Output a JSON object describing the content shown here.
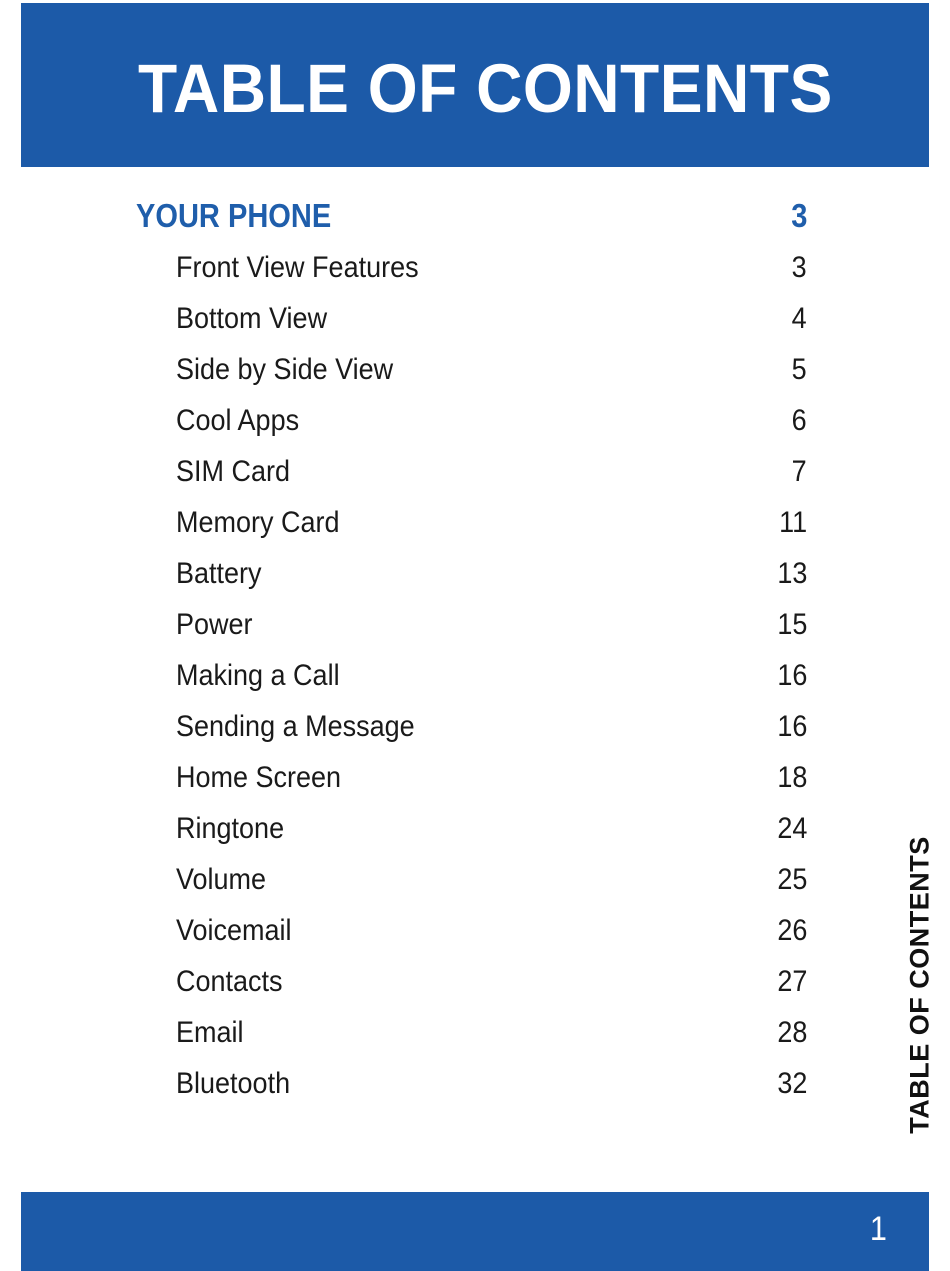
{
  "document": {
    "page_title": "TABLE OF CONTENTS",
    "page_number": "1",
    "side_tab_label": "TABLE OF CONTENTS"
  },
  "colors": {
    "brand_blue": "#1c5aa8",
    "heading_blue": "#1f5eab",
    "body_text": "#1a1a1a",
    "banner_text": "#ffffff"
  },
  "toc": {
    "section": {
      "label": "YOUR PHONE",
      "page": "3"
    },
    "entries": [
      {
        "label": "Front View Features",
        "page": "3"
      },
      {
        "label": "Bottom View",
        "page": "4"
      },
      {
        "label": "Side by Side View",
        "page": "5"
      },
      {
        "label": "Cool Apps",
        "page": "6"
      },
      {
        "label": "SIM Card",
        "page": "7"
      },
      {
        "label": "Memory Card",
        "page": "11"
      },
      {
        "label": "Battery",
        "page": "13"
      },
      {
        "label": "Power",
        "page": "15"
      },
      {
        "label": "Making a Call",
        "page": "16"
      },
      {
        "label": "Sending a Message",
        "page": "16"
      },
      {
        "label": "Home Screen",
        "page": "18"
      },
      {
        "label": "Ringtone",
        "page": "24"
      },
      {
        "label": "Volume",
        "page": "25"
      },
      {
        "label": "Voicemail",
        "page": "26"
      },
      {
        "label": "Contacts",
        "page": "27"
      },
      {
        "label": "Email",
        "page": "28"
      },
      {
        "label": "Bluetooth",
        "page": "32"
      }
    ]
  }
}
